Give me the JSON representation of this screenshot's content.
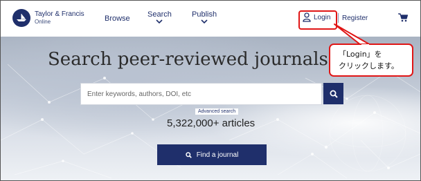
{
  "header": {
    "logo": {
      "name": "Taylor & Francis",
      "sub": "Online"
    },
    "nav": [
      {
        "label": "Browse",
        "has_dropdown": false
      },
      {
        "label": "Search",
        "has_dropdown": true
      },
      {
        "label": "Publish",
        "has_dropdown": true
      }
    ],
    "login_label": "Login",
    "register_label": "Register"
  },
  "hero": {
    "headline": "Search peer-reviewed journals and a",
    "search": {
      "placeholder": "Enter keywords, authors, DOI, etc"
    },
    "advanced_search_label": "Advanced search",
    "article_count": "5,322,000+ articles",
    "find_journal_label": "Find a journal"
  },
  "callout": {
    "line1": "「Login」を",
    "line2": "クリックします。"
  },
  "colors": {
    "brand": "#1f2f6b",
    "highlight": "#e01515"
  },
  "icons": [
    "logo-ship-icon",
    "chevron-down-icon",
    "user-icon",
    "cart-icon",
    "search-icon"
  ]
}
